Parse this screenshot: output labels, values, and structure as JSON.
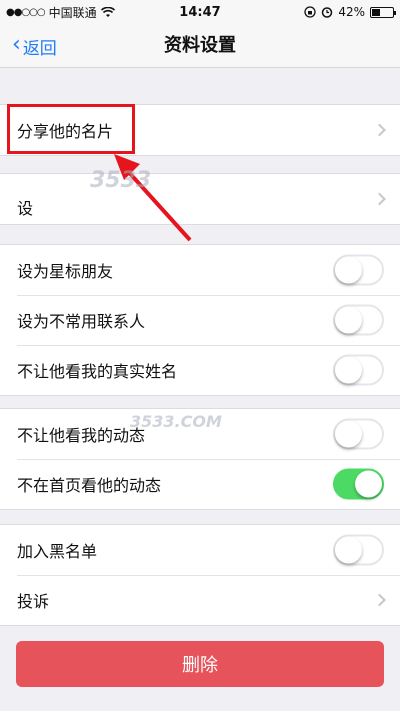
{
  "status_bar": {
    "signal": "●●○○○",
    "carrier": "中国联通",
    "time": "14:47",
    "battery_percent": "42%",
    "battery_level": 0.42
  },
  "nav": {
    "back_label": "返回",
    "title": "资料设置"
  },
  "groups": [
    {
      "rows": [
        {
          "label": "分享他的名片"
        }
      ]
    },
    {
      "rows": [
        {
          "label": "设"
        }
      ]
    },
    {
      "rows": [
        {
          "label": "设为星标朋友",
          "on": false
        },
        {
          "label": "设为不常用联系人",
          "on": false
        },
        {
          "label": "不让他看我的真实姓名",
          "on": false
        }
      ]
    },
    {
      "rows": [
        {
          "label": "不让他看我的动态",
          "on": false
        },
        {
          "label": "不在首页看他的动态",
          "on": true
        }
      ]
    },
    {
      "rows": [
        {
          "label": "加入黑名单",
          "on": false
        },
        {
          "label": "投诉"
        }
      ]
    }
  ],
  "delete_label": "删除",
  "colors": {
    "accent": "#1f7cf4",
    "toggle_on": "#4cd964",
    "delete": "#e6535a",
    "highlight": "#e5141d"
  }
}
